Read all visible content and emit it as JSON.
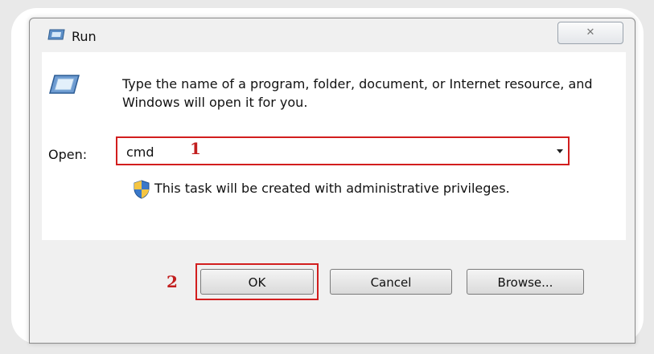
{
  "window": {
    "title": "Run",
    "close_label": "✕"
  },
  "dialog": {
    "description": "Type the name of a program, folder, document, or Internet resource, and Windows will open it for you.",
    "open_label": "Open:",
    "open_value": "cmd",
    "admin_note": "This task will be created with administrative privileges."
  },
  "buttons": {
    "ok": "OK",
    "cancel": "Cancel",
    "browse": "Browse..."
  },
  "annotations": {
    "step1": "1",
    "step2": "2"
  },
  "colors": {
    "highlight": "#d21e1e",
    "marker": "#c21e1e"
  },
  "icons": [
    "run-icon",
    "program-icon",
    "uac-shield-icon",
    "close-icon",
    "dropdown-arrow-icon"
  ]
}
